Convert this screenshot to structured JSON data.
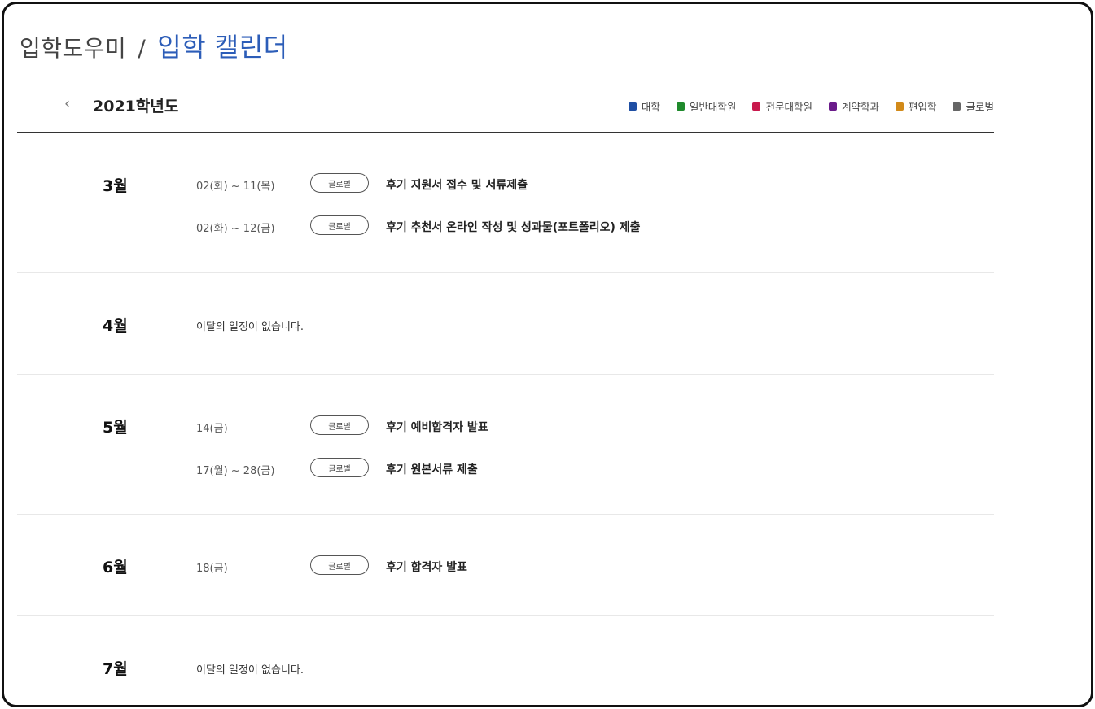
{
  "header": {
    "crumb": "입학도우미",
    "separator": "/",
    "current": "입학 캘린더"
  },
  "year_nav": {
    "prev_icon": "chevron-left-icon",
    "prev_glyph": "‹",
    "year_label": "2021학년도"
  },
  "legend": [
    {
      "label": "대학",
      "color": "#1f4ea3"
    },
    {
      "label": "일반대학원",
      "color": "#1f8a2c"
    },
    {
      "label": "전문대학원",
      "color": "#c8194d"
    },
    {
      "label": "계약학과",
      "color": "#6a1b8a"
    },
    {
      "label": "편입학",
      "color": "#d28a19"
    },
    {
      "label": "글로벌",
      "color": "#666666"
    }
  ],
  "months": [
    {
      "label": "3월",
      "events": [
        {
          "date": "02(화) ~ 11(목)",
          "badge": "글로벌",
          "title": "후기 지원서 접수 및 서류제출"
        },
        {
          "date": "02(화) ~ 12(금)",
          "badge": "글로벌",
          "title": "후기 추천서 온라인 작성 및 성과물(포트폴리오) 제출"
        }
      ]
    },
    {
      "label": "4월",
      "empty": "이달의 일정이 없습니다."
    },
    {
      "label": "5월",
      "events": [
        {
          "date": "14(금)",
          "badge": "글로벌",
          "title": "후기 예비합격자 발표"
        },
        {
          "date": "17(월) ~ 28(금)",
          "badge": "글로벌",
          "title": "후기 원본서류 제출"
        }
      ]
    },
    {
      "label": "6월",
      "events": [
        {
          "date": "18(금)",
          "badge": "글로벌",
          "title": "후기 합격자 발표"
        }
      ]
    },
    {
      "label": "7월",
      "empty": "이달의 일정이 없습니다."
    }
  ]
}
